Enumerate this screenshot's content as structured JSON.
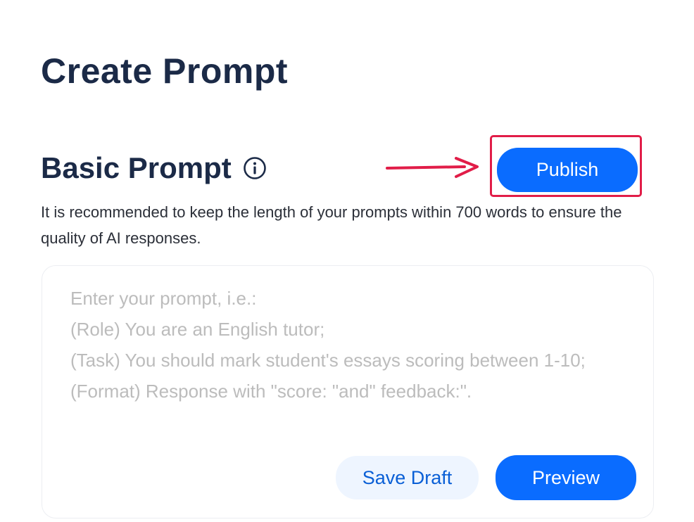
{
  "page": {
    "title": "Create Prompt"
  },
  "section": {
    "title": "Basic Prompt",
    "info_icon": "info-circle-icon",
    "description": "It is recommended to keep the length of your prompts within 700 words to ensure the quality of AI responses."
  },
  "actions": {
    "publish_label": "Publish",
    "save_draft_label": "Save Draft",
    "preview_label": "Preview"
  },
  "prompt_input": {
    "value": "",
    "placeholder": "Enter your prompt, i.e.:\n(Role) You are an English tutor;\n(Task) You should mark student's essays scoring between 1-10;\n(Format) Response with \"score: \"and\" feedback:\"."
  },
  "annotation": {
    "arrow_icon": "arrow-right-icon",
    "highlight_color": "#e11d48"
  },
  "colors": {
    "primary": "#0a6cff",
    "heading": "#1b2a47",
    "secondary_button_bg": "#eef5ff",
    "placeholder": "#bcbcbc"
  }
}
